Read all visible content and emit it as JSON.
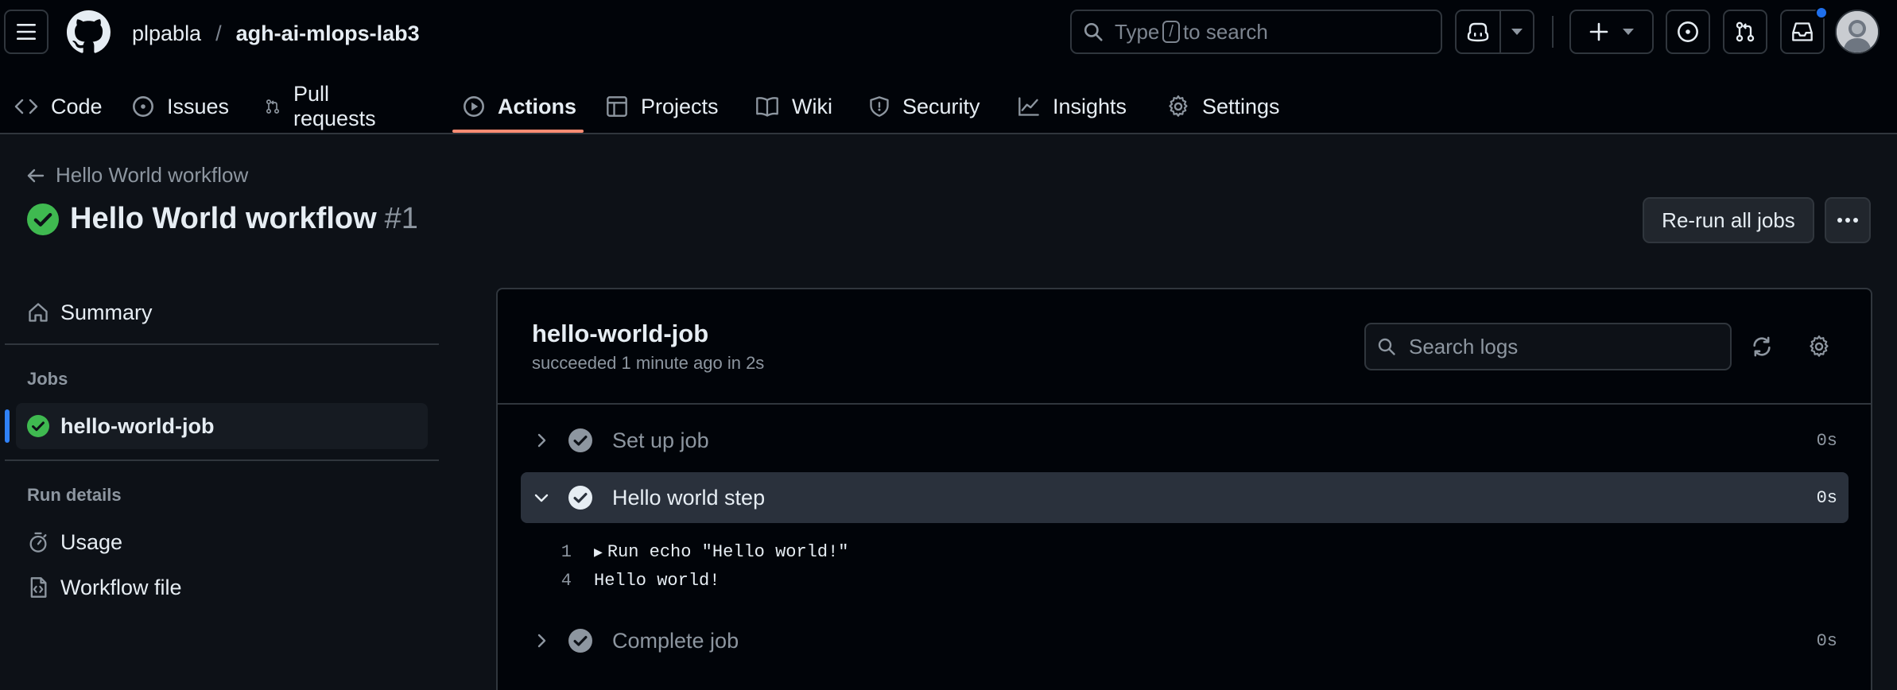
{
  "header": {
    "owner": "plpabla",
    "separator": "/",
    "repo": "agh-ai-mlops-lab3",
    "search": {
      "prefix": "Type",
      "key": "/",
      "suffix": "to search"
    },
    "notification_dot_color": "#1f6feb"
  },
  "tabs": [
    {
      "label": "Code",
      "icon": "code-icon"
    },
    {
      "label": "Issues",
      "icon": "issue-opened-icon"
    },
    {
      "label": "Pull requests",
      "icon": "git-pull-request-icon"
    },
    {
      "label": "Actions",
      "icon": "play-icon",
      "active": true
    },
    {
      "label": "Projects",
      "icon": "table-icon"
    },
    {
      "label": "Wiki",
      "icon": "book-icon"
    },
    {
      "label": "Security",
      "icon": "shield-icon"
    },
    {
      "label": "Insights",
      "icon": "graph-icon"
    },
    {
      "label": "Settings",
      "icon": "gear-icon"
    }
  ],
  "run": {
    "back_label": "Hello World workflow",
    "title": "Hello World workflow",
    "number": "#1",
    "status_color": "#3fb950",
    "rerun_label": "Re-run all jobs"
  },
  "sidebar": {
    "summary_label": "Summary",
    "jobs_heading": "Jobs",
    "jobs": [
      {
        "label": "hello-world-job",
        "status": "success",
        "selected": true
      }
    ],
    "run_details_heading": "Run details",
    "usage_label": "Usage",
    "workflow_file_label": "Workflow file"
  },
  "job": {
    "title": "hello-world-job",
    "subtitle": "succeeded 1 minute ago in 2s",
    "search_placeholder": "Search logs",
    "steps": [
      {
        "label": "Set up job",
        "duration": "0s",
        "expanded": false
      },
      {
        "label": "Hello world step",
        "duration": "0s",
        "expanded": true
      },
      {
        "label": "Complete job",
        "duration": "0s",
        "expanded": false
      }
    ],
    "log_lines": [
      {
        "number": "1",
        "text": "Run echo \"Hello world!\"",
        "collapsible": true
      },
      {
        "number": "4",
        "text": "Hello world!",
        "collapsible": false
      }
    ]
  }
}
